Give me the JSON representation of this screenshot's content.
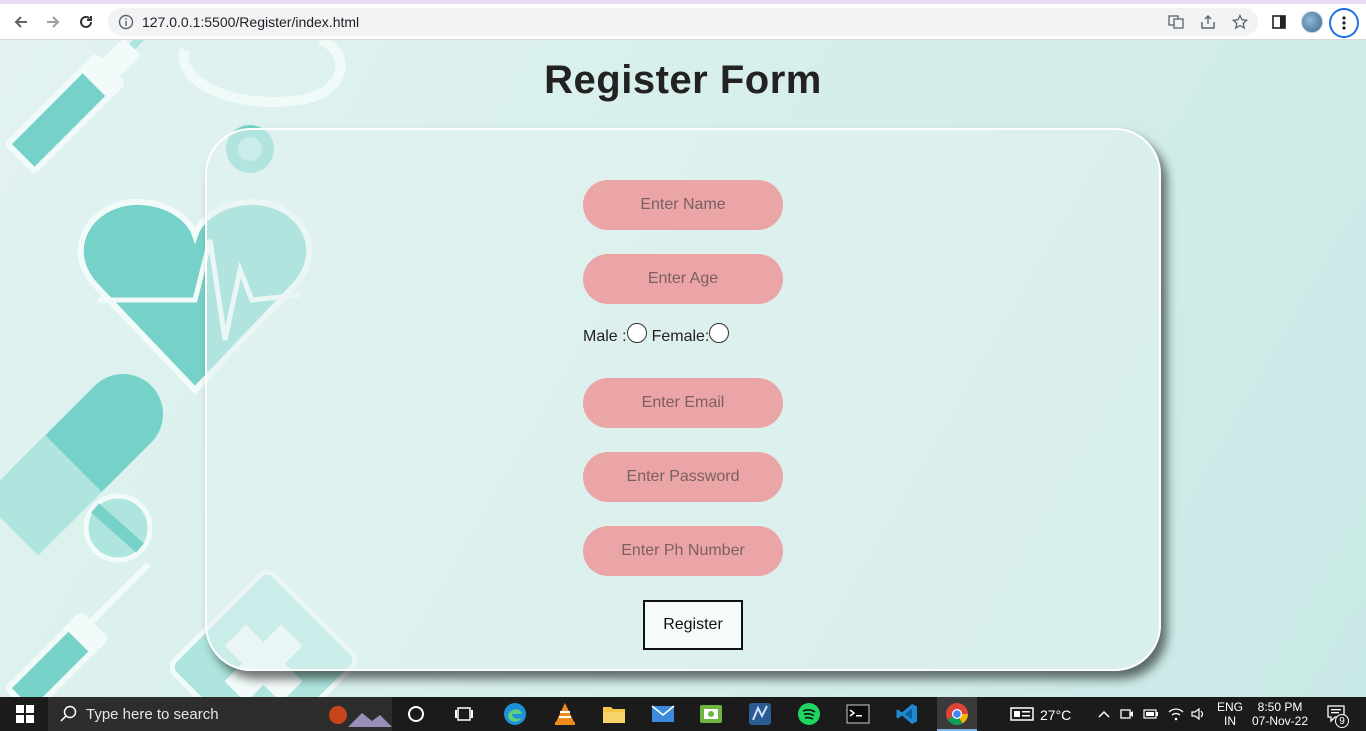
{
  "browser": {
    "url": "127.0.0.1:5500/Register/index.html"
  },
  "page": {
    "title": "Register Form",
    "fields": {
      "name_placeholder": "Enter Name",
      "age_placeholder": "Enter Age",
      "email_placeholder": "Enter Email",
      "password_placeholder": "Enter Password",
      "phone_placeholder": "Enter Ph Number"
    },
    "gender": {
      "male_label": "Male :",
      "female_label": "Female:"
    },
    "register_label": "Register"
  },
  "taskbar": {
    "search_placeholder": "Type here to search",
    "weather": "27°C",
    "language": "ENG",
    "region": "IN",
    "time": "8:50 PM",
    "date": "07-Nov-22",
    "notification_count": "9"
  },
  "colors": {
    "field_bg": "#eca5a6",
    "page_bg": "#d6eeeb",
    "accent": "#76d2c8"
  }
}
